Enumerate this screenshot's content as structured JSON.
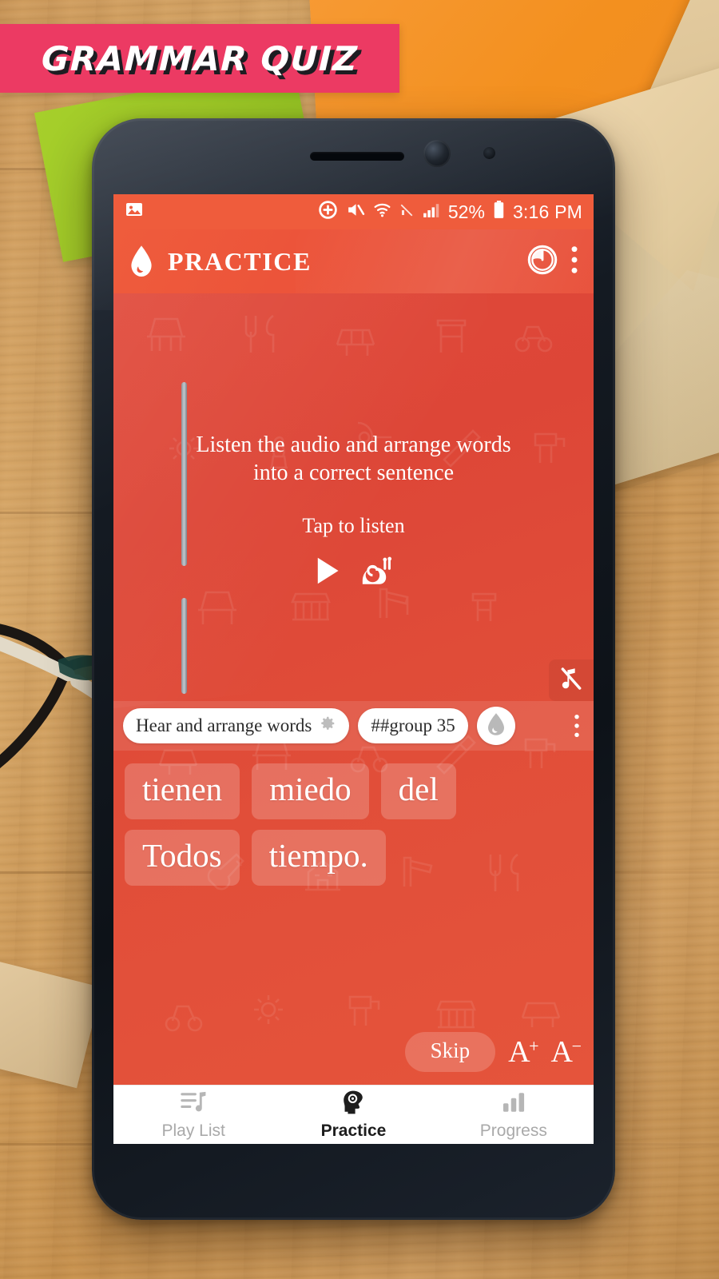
{
  "banner": {
    "title": "GRAMMAR QUIZ",
    "bg_color": "#ec3a63",
    "text_color": "#ffffff",
    "shadow_color": "#1d1d22"
  },
  "scene": {
    "surface": "wooden-desk",
    "props": [
      "orange-paper-sheet",
      "kraft-envelope",
      "second-envelope",
      "green-notepad",
      "eyeglasses",
      "kraft-paper-scrap"
    ]
  },
  "device": {
    "type": "smartphone",
    "bezel_color": "#131a22"
  },
  "statusbar": {
    "left_icon": "image-icon",
    "icons": [
      "add-circle-icon",
      "volume-mute-icon",
      "wifi-icon",
      "signal-off-icon",
      "cell-signal-icon"
    ],
    "battery_percent": "52%",
    "battery_icon": "battery-icon",
    "time": "3:16 PM",
    "bg_color": "#ef5c3c"
  },
  "appbar": {
    "logo": "water-drop-icon",
    "title": "PRACTICE",
    "timer_icon": "timer-icon",
    "overflow_icon": "more-vertical-icon",
    "bg_color": "#ec543a"
  },
  "main": {
    "instruction_line1": "Listen the audio and arrange words",
    "instruction_line2": "into a correct sentence",
    "tap_hint": "Tap to listen",
    "play_icon": "play-icon",
    "slow_icon": "snail-icon",
    "mute_icon": "music-note-off-icon",
    "bg_color": "#dd4637"
  },
  "chipbar": {
    "mode_chip": {
      "label": "Hear and arrange words",
      "icon": "gear-icon"
    },
    "group_chip": {
      "label": "##group 35"
    },
    "round_button_icon": "drop-silhouette-icon",
    "overflow_icon": "more-vertical-icon"
  },
  "word_tiles": [
    "tienen",
    "miedo",
    "del",
    "Todos",
    "tiempo."
  ],
  "actions": {
    "skip_label": "Skip",
    "font_increase": "A",
    "font_increase_sup": "+",
    "font_decrease": "A",
    "font_decrease_sup": "−"
  },
  "bottomnav": {
    "items": [
      {
        "label": "Play List",
        "icon": "playlist-music-icon",
        "active": false
      },
      {
        "label": "Practice",
        "icon": "head-gear-icon",
        "active": true
      },
      {
        "label": "Progress",
        "icon": "bar-chart-icon",
        "active": false
      }
    ]
  }
}
